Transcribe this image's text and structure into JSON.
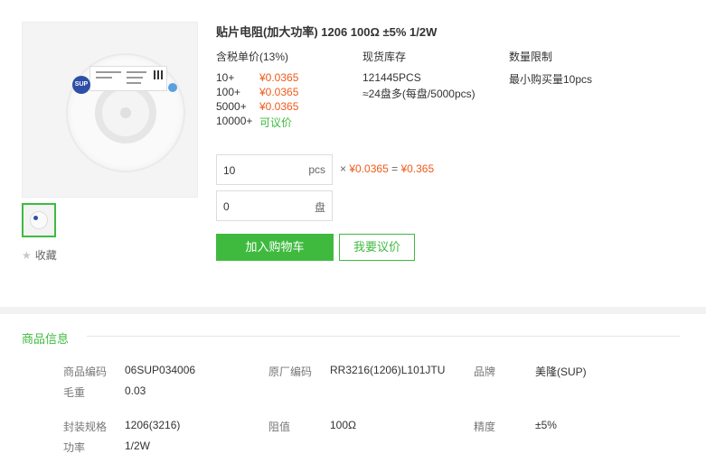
{
  "product": {
    "title": "贴片电阻(加大功率) 1206 100Ω ±5% 1/2W",
    "favorite_label": "收藏",
    "image_badge": "SUP"
  },
  "headers": {
    "price": "含税单价(13%)",
    "stock": "现货库存",
    "limit": "数量限制"
  },
  "price_tiers": [
    {
      "qty": "10+",
      "price": "¥0.0365"
    },
    {
      "qty": "100+",
      "price": "¥0.0365"
    },
    {
      "qty": "5000+",
      "price": "¥0.0365"
    },
    {
      "qty": "10000+",
      "price": "可议价"
    }
  ],
  "stock": {
    "pcs": "121445PCS",
    "reels": "≈24盘多(每盘/5000pcs)"
  },
  "limit": "最小购买量10pcs",
  "order": {
    "qty_value": "10",
    "qty_unit": "pcs",
    "reel_value": "0",
    "reel_unit": "盘",
    "times": "×",
    "unit_price": "¥0.0365",
    "equals": "=",
    "total": "¥0.365"
  },
  "buttons": {
    "add_to_cart": "加入购物车",
    "quote": "我要议价"
  },
  "info": {
    "section_title": "商品信息",
    "specs": [
      {
        "key": "商品编码",
        "value": "06SUP034006"
      },
      {
        "key": "原厂编码",
        "value": "RR3216(1206)L101JTU"
      },
      {
        "key": "品牌",
        "value": "美隆(SUP)"
      },
      {
        "key": "毛重",
        "value": "0.03"
      },
      {
        "key": "封装规格",
        "value": "1206(3216)"
      },
      {
        "key": "阻值",
        "value": "100Ω"
      },
      {
        "key": "精度",
        "value": "±5%"
      },
      {
        "key": "功率",
        "value": "1/2W"
      }
    ]
  },
  "colors": {
    "accent": "#3fba3f",
    "price": "#f05a1a"
  }
}
